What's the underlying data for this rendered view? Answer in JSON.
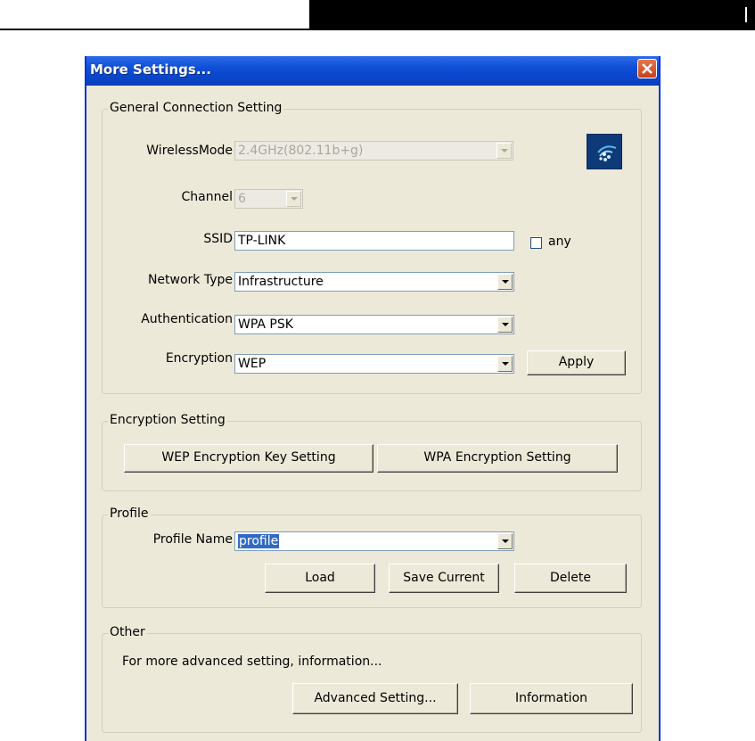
{
  "window": {
    "title": "More Settings..."
  },
  "general": {
    "legend": "General Connection Setting",
    "wireless_mode_label": "WirelessMode",
    "wireless_mode_value": "2.4GHz(802.11b+g)",
    "channel_label": "Channel",
    "channel_value": "6",
    "ssid_label": "SSID",
    "ssid_value": "TP-LINK",
    "any_label": "any",
    "network_type_label": "Network Type",
    "network_type_value": "Infrastructure",
    "authentication_label": "Authentication",
    "authentication_value": "WPA PSK",
    "encryption_label": "Encryption",
    "encryption_value": "WEP",
    "apply_label": "Apply"
  },
  "encryption_setting": {
    "legend": "Encryption Setting",
    "wep_button": "WEP Encryption Key Setting",
    "wpa_button": "WPA Encryption Setting"
  },
  "profile": {
    "legend": "Profile",
    "name_label": "Profile Name",
    "name_value": "profile",
    "load_label": "Load",
    "save_label": "Save Current",
    "delete_label": "Delete"
  },
  "other": {
    "legend": "Other",
    "text": "For more advanced setting, information...",
    "advanced_label": "Advanced Setting...",
    "information_label": "Information"
  },
  "colors": {
    "title_bar": "#0a46cc",
    "dialog_bg": "#ece9d8",
    "selection": "#316ac5",
    "close_button": "#c9401b"
  },
  "icons": {
    "close": "close-icon",
    "wireless": "wireless-icon"
  }
}
